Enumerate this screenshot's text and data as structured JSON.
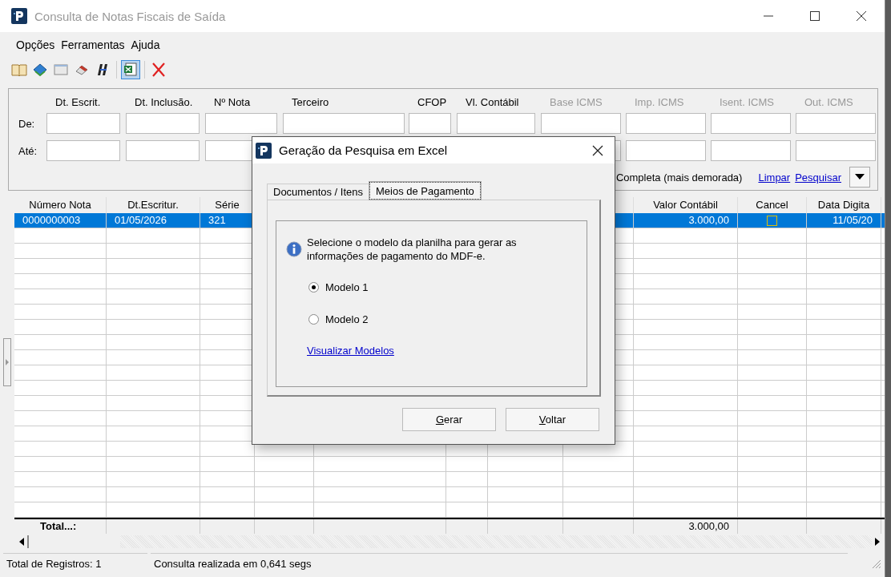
{
  "window": {
    "title": "Consulta de Notas Fiscais de Saída"
  },
  "menu": [
    "Opções",
    "Ferramentas",
    "Ajuda"
  ],
  "toolbar": [
    {
      "kind": "book",
      "selected": false
    },
    {
      "kind": "bluebook",
      "selected": false
    },
    {
      "kind": "window",
      "selected": false
    },
    {
      "kind": "eraser",
      "selected": false
    },
    {
      "kind": "stripes",
      "selected": false
    },
    {
      "kind": "sheet",
      "selected": true
    },
    {
      "kind": "delete",
      "selected": false
    }
  ],
  "filters": {
    "row_labels": [
      "De:",
      "Até:"
    ],
    "columns": [
      {
        "label": "Dt. Escrit.",
        "disabled": false
      },
      {
        "label": "Dt. Inclusão.",
        "disabled": false
      },
      {
        "label": "Nº Nota",
        "disabled": false
      },
      {
        "label": "Terceiro",
        "disabled": false
      },
      {
        "label": "CFOP",
        "disabled": false
      },
      {
        "label": "Vl. Contábil",
        "disabled": false
      },
      {
        "label": "Base ICMS",
        "disabled": true
      },
      {
        "label": "Imp. ICMS",
        "disabled": true
      },
      {
        "label": "Isent. ICMS",
        "disabled": true
      },
      {
        "label": "Out. ICMS",
        "disabled": true
      }
    ],
    "option_label": "Completa (mais demorada)",
    "links": [
      "Limpar",
      "Pesquisar"
    ]
  },
  "grid": {
    "columns": [
      "Número Nota",
      "Dt.Escritur.",
      "Série",
      "Valor Contábil",
      "Cancel",
      "Data Digita"
    ],
    "rows": [
      {
        "selected": true,
        "cells": [
          "0000000003",
          "01/05/2026",
          "321",
          "3.000,00",
          "",
          "11/05/20"
        ],
        "cancel": false
      }
    ],
    "totals": {
      "label": "Total...:",
      "value": "3.000,00"
    }
  },
  "status_bar": [
    "Total de Registros: 1",
    "Consulta realizada em 0,641 segs"
  ],
  "dialog": {
    "title": "Geração da Pesquisa em Excel",
    "tabs": [
      {
        "label": "Documentos / Itens",
        "selected": false
      },
      {
        "label": "Meios de Pagamento",
        "selected": true
      }
    ],
    "message": "Selecione o modelo da planilha para gerar as informações de pagamento do MDF-e.",
    "options": [
      {
        "label": "Modelo 1",
        "selected": true
      },
      {
        "label": "Modelo 2",
        "selected": false
      }
    ],
    "link": "Visualizar Modelos",
    "buttons": [
      "Gerar",
      "Voltar"
    ]
  }
}
